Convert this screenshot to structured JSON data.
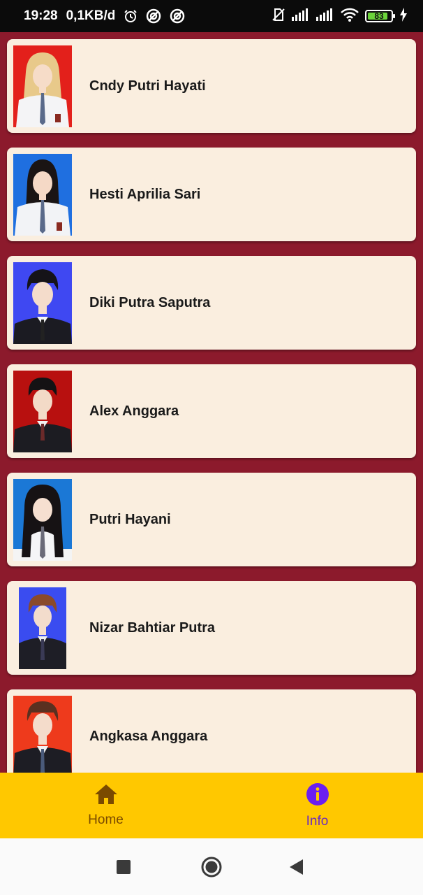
{
  "status_bar": {
    "time": "19:28",
    "network_speed": "0,1KB/d",
    "battery_level": "83",
    "icons": [
      "alarm-icon",
      "app-notification-icon",
      "app-notification-icon",
      "no-sim-icon",
      "signal-icon",
      "signal-icon",
      "wifi-icon",
      "battery-icon",
      "charging-icon"
    ]
  },
  "students": [
    {
      "name": "Cndy Putri Hayati",
      "photo_bg": "#e3201b",
      "uniform": "school-white",
      "hair": "blonde-long"
    },
    {
      "name": "Hesti Aprilia Sari",
      "photo_bg": "#1f6fe0",
      "uniform": "school-white",
      "hair": "dark-long"
    },
    {
      "name": "Diki Putra Saputra",
      "photo_bg": "#3f48f2",
      "uniform": "black-suit",
      "hair": "dark-short"
    },
    {
      "name": "Alex Anggara",
      "photo_bg": "#b8100f",
      "uniform": "black-suit",
      "hair": "dark-short"
    },
    {
      "name": "Putri Hayani",
      "photo_bg": "#1b78d6",
      "uniform": "school-white",
      "hair": "dark-long"
    },
    {
      "name": "Nizar Bahtiar Putra",
      "photo_bg": "#3a4cf0",
      "uniform": "black-suit",
      "hair": "brown-short"
    },
    {
      "name": "Angkasa Anggara",
      "photo_bg": "#ee3a1c",
      "uniform": "black-suit",
      "hair": "brown-short"
    }
  ],
  "bottom_nav": {
    "items": [
      {
        "label": "Home",
        "icon": "home-icon",
        "color": "#7a4a00"
      },
      {
        "label": "Info",
        "icon": "info-icon",
        "color": "#6b2bc0",
        "selected": true
      }
    ],
    "background": "#ffc800"
  },
  "system_nav": {
    "buttons": [
      "recents-square-icon",
      "home-circle-icon",
      "back-triangle-icon"
    ]
  },
  "colors": {
    "page_background": "#8c1a2c",
    "card_background": "#faeedf"
  }
}
